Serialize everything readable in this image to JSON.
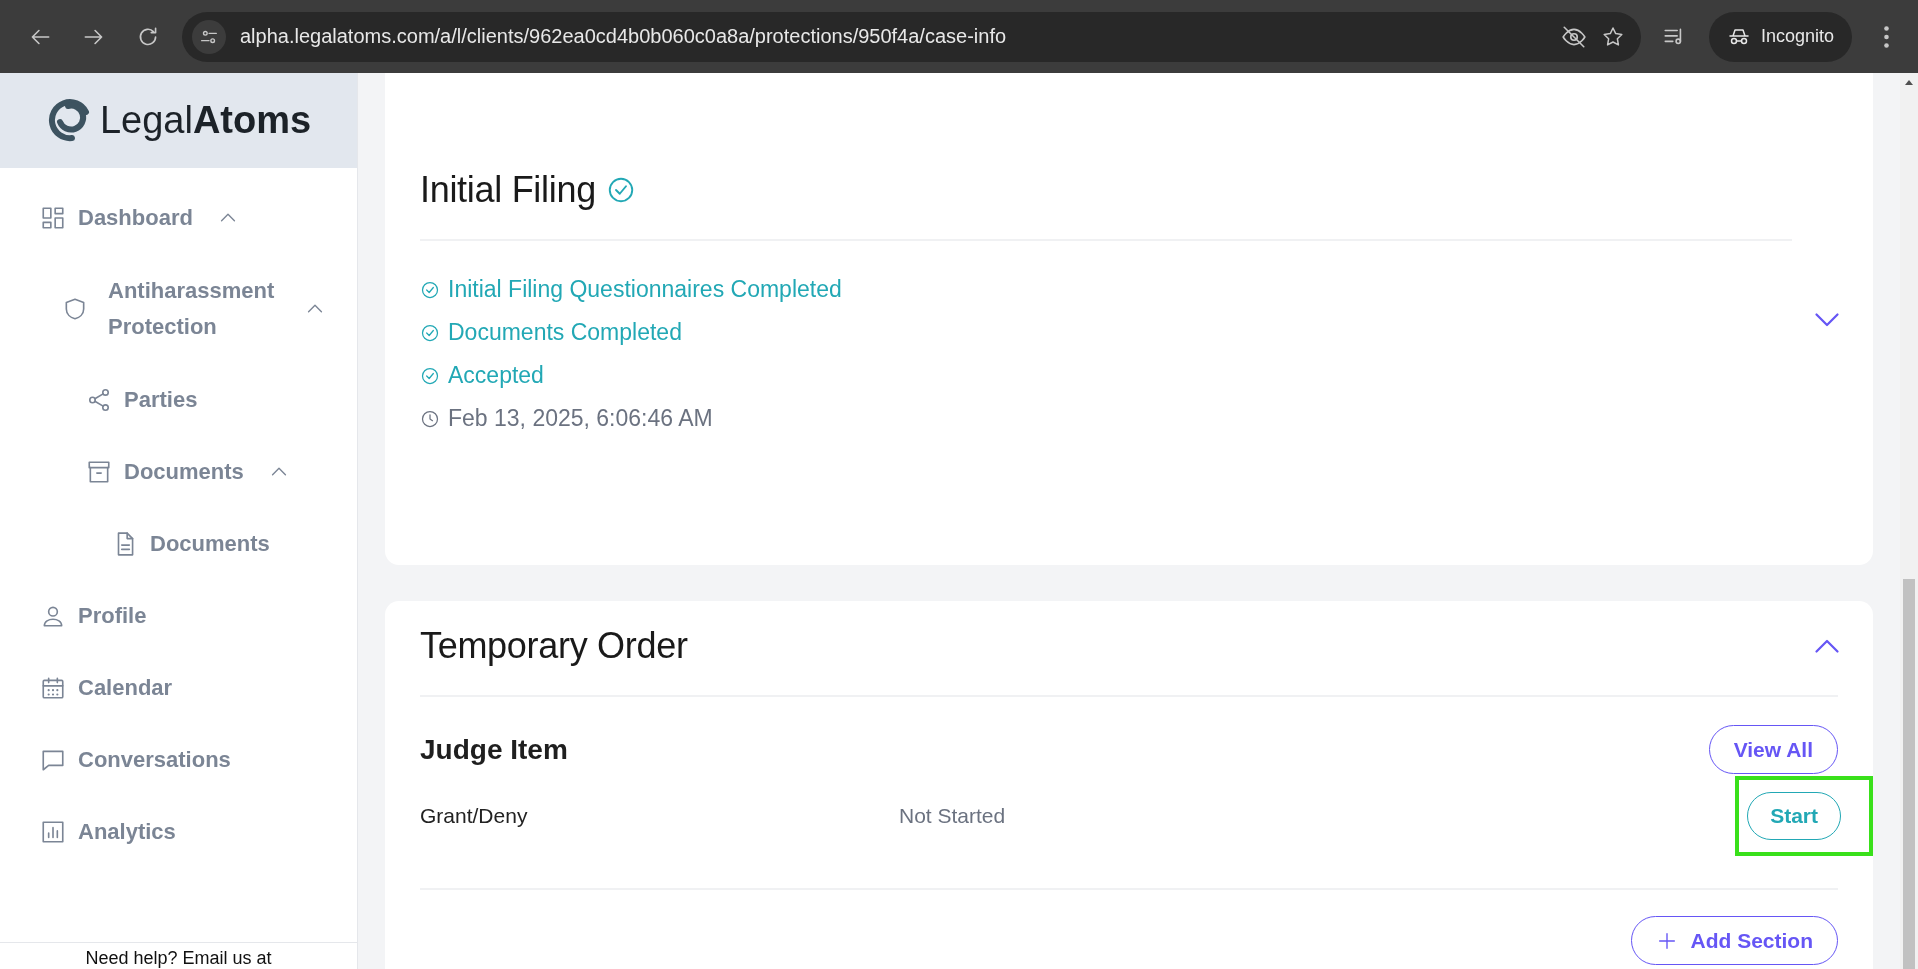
{
  "browser": {
    "url": "alpha.legalatoms.com/a/l/clients/962ea0cd4b0b060c0a8a/protections/950f4a/case-info",
    "profile": "Incognito"
  },
  "sidebar": {
    "logo": "Legal**Atoms**",
    "items": [
      {
        "label": "Dashboard",
        "expanded": true,
        "children": [
          {
            "label": "Antiharassment Protection",
            "expanded": true,
            "children": [
              {
                "label": "Parties"
              },
              {
                "label": "Documents",
                "expanded": true,
                "children": [
                  {
                    "label": "Documents"
                  }
                ]
              }
            ]
          }
        ]
      },
      {
        "label": "Profile"
      },
      {
        "label": "Calendar"
      },
      {
        "label": "Conversations"
      },
      {
        "label": "Analytics"
      }
    ],
    "footer": "Need help? Email us at"
  },
  "sections": [
    {
      "title": "Initial Filing",
      "completed": true,
      "expanded": false,
      "statuses": [
        {
          "kind": "done",
          "text": "Initial Filing Questionnaires Completed"
        },
        {
          "kind": "done",
          "text": "Documents Completed"
        },
        {
          "kind": "done",
          "text": "Accepted"
        },
        {
          "kind": "time",
          "text": "Feb 13, 2025, 6:06:46 AM"
        }
      ]
    },
    {
      "title": "Temporary Order",
      "completed": false,
      "expanded": true,
      "groups": [
        {
          "title": "Judge Item",
          "action": "View All",
          "items": [
            {
              "name": "Grant/Deny",
              "status": "Not Started",
              "action": "Start",
              "highlighted": true
            }
          ]
        }
      ],
      "add_button": "Add Section"
    }
  ]
}
